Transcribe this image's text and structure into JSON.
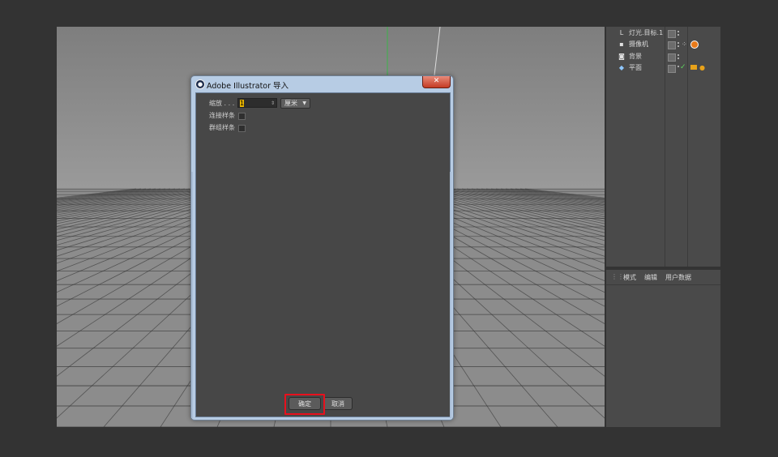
{
  "dialog": {
    "title": "Adobe Illustrator 导入",
    "close_glyph": "✕",
    "scale_label": "缩放 . . .",
    "scale_value": "1",
    "unit": "厘米",
    "connect_splines_label": "连接样条",
    "group_splines_label": "群组样条",
    "ok_label": "确定",
    "cancel_label": "取消"
  },
  "object_manager": {
    "items": [
      {
        "name": "灯光.目标.1",
        "icon": "light-target-icon"
      },
      {
        "name": "摄像机",
        "icon": "camera-icon"
      },
      {
        "name": "背景",
        "icon": "background-icon"
      },
      {
        "name": "平面",
        "icon": "plane-icon"
      }
    ]
  },
  "attributes": {
    "tabs": [
      "模式",
      "编辑",
      "用户数据"
    ]
  },
  "colors": {
    "app_bg": "#333333",
    "panel": "#4a4a4a",
    "viewport_floor": "#8a8a8a",
    "highlight": "#e8101d",
    "title_bar": "#b7cce4"
  }
}
